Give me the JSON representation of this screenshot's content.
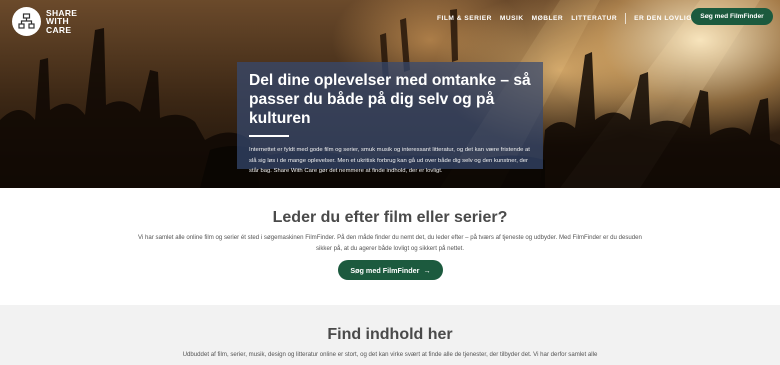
{
  "brand": {
    "logo_line1": "SHARE",
    "logo_line2": "WITH",
    "logo_line3": "CARE"
  },
  "nav": {
    "items": [
      "FILM & SERIER",
      "MUSIK",
      "MØBLER",
      "LITTERATUR",
      "ER DEN LOVLIG?",
      "OM"
    ],
    "cta_label": "Søg med FilmFinder"
  },
  "hero": {
    "title": "Del dine oplevelser med omtanke – så passer du både på dig selv og på kulturen",
    "text": "Internettet er fyldt med gode film og serier, smuk musik og interessant litteratur, og det kan være fristende at slå sig løs i de mange oplevelser. Men et ukritisk forbrug kan gå ud over både dig selv og den kunstner, der står bag. Share With Care gør det nemmere at finde indhold, der er lovligt."
  },
  "section1": {
    "title": "Leder du efter film eller serier?",
    "text": "Vi har samlet alle online film og serier ét sted i søgemaskinen FilmFinder. På den måde finder du nemt det, du leder efter – på tværs af tjeneste og udbyder. Med FilmFinder er du desuden sikker på, at du agerer både lovligt og sikkert på nettet.",
    "button_label": "Søg med FilmFinder",
    "button_arrow": "→"
  },
  "section2": {
    "title": "Find indhold her",
    "text": "Udbuddet af film, serier, musik, design og litteratur online er stort, og det kan virke svært at finde alle de tjenester, der tilbyder det. Vi har derfor samlet alle"
  },
  "colors": {
    "accent": "#1c5a3e",
    "hero_box": "#364a70"
  }
}
